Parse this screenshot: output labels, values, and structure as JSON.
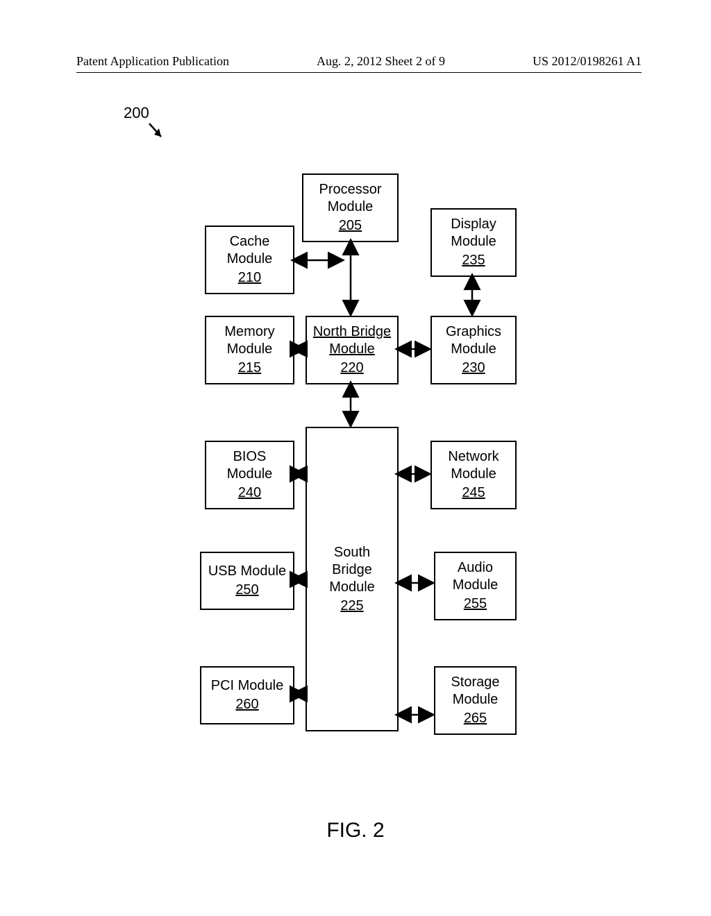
{
  "header": {
    "left": "Patent Application Publication",
    "center": "Aug. 2, 2012  Sheet 2 of 9",
    "right": "US 2012/0198261 A1"
  },
  "ref_label": "200",
  "blocks": {
    "processor": {
      "name": "Processor\nModule",
      "num": "205"
    },
    "cache": {
      "name": "Cache\nModule",
      "num": "210"
    },
    "memory": {
      "name": "Memory\nModule",
      "num": "215"
    },
    "northbridge": {
      "name": "North Bridge\nModule",
      "num": "220"
    },
    "southbridge": {
      "name": "South\nBridge\nModule",
      "num": "225"
    },
    "graphics": {
      "name": "Graphics\nModule",
      "num": "230"
    },
    "display": {
      "name": "Display\nModule",
      "num": "235"
    },
    "bios": {
      "name": "BIOS\nModule",
      "num": "240"
    },
    "network": {
      "name": "Network\nModule",
      "num": "245"
    },
    "usb": {
      "name": "USB Module",
      "num": "250"
    },
    "audio": {
      "name": "Audio\nModule",
      "num": "255"
    },
    "pci": {
      "name": "PCI Module",
      "num": "260"
    },
    "storage": {
      "name": "Storage\nModule",
      "num": "265"
    }
  },
  "figure_caption": "FIG. 2",
  "chart_data": {
    "type": "block-diagram",
    "title": "FIG. 2",
    "reference_numeral": "200",
    "nodes": [
      {
        "id": "205",
        "label": "Processor Module"
      },
      {
        "id": "210",
        "label": "Cache Module"
      },
      {
        "id": "215",
        "label": "Memory Module"
      },
      {
        "id": "220",
        "label": "North Bridge Module"
      },
      {
        "id": "225",
        "label": "South Bridge Module"
      },
      {
        "id": "230",
        "label": "Graphics Module"
      },
      {
        "id": "235",
        "label": "Display Module"
      },
      {
        "id": "240",
        "label": "BIOS Module"
      },
      {
        "id": "245",
        "label": "Network Module"
      },
      {
        "id": "250",
        "label": "USB Module"
      },
      {
        "id": "255",
        "label": "Audio Module"
      },
      {
        "id": "260",
        "label": "PCI Module"
      },
      {
        "id": "265",
        "label": "Storage Module"
      }
    ],
    "edges": [
      {
        "from": "205",
        "to": "220",
        "bidirectional": true
      },
      {
        "from": "210",
        "to": "220",
        "bidirectional": true
      },
      {
        "from": "215",
        "to": "220",
        "bidirectional": true
      },
      {
        "from": "230",
        "to": "220",
        "bidirectional": true
      },
      {
        "from": "235",
        "to": "230",
        "bidirectional": true
      },
      {
        "from": "220",
        "to": "225",
        "bidirectional": true
      },
      {
        "from": "240",
        "to": "225",
        "bidirectional": true
      },
      {
        "from": "245",
        "to": "225",
        "bidirectional": true
      },
      {
        "from": "250",
        "to": "225",
        "bidirectional": true
      },
      {
        "from": "255",
        "to": "225",
        "bidirectional": true
      },
      {
        "from": "260",
        "to": "225",
        "bidirectional": true
      },
      {
        "from": "265",
        "to": "225",
        "bidirectional": true
      }
    ]
  }
}
